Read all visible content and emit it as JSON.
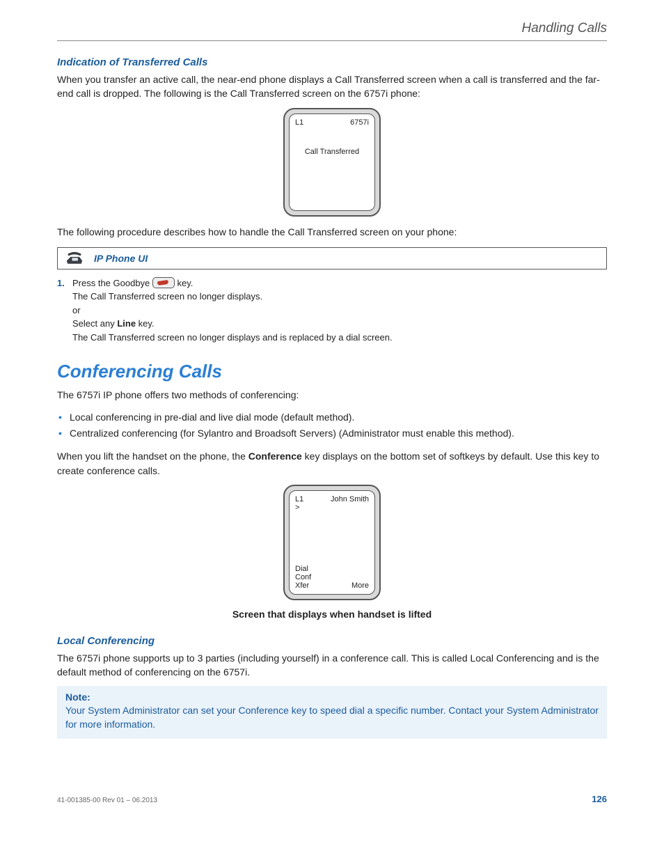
{
  "header": {
    "running": "Handling Calls"
  },
  "sec1": {
    "title": "Indication of Transferred Calls",
    "p1": "When you transfer an active call, the near-end phone displays a Call Transferred screen when a call is transferred and the far-end call is dropped. The following is the Call Transferred screen on the 6757i phone:",
    "p2": "The following procedure describes how to handle the Call Transferred screen on your phone:"
  },
  "phone1": {
    "line": "L1",
    "model": "6757i",
    "status": "Call Transferred"
  },
  "uiBox": {
    "label": "IP Phone UI"
  },
  "step1": {
    "num": "1.",
    "a1": "Press the Goodbye ",
    "a2": " key.",
    "b": "The Call Transferred screen no longer displays.",
    "c": "or",
    "d_pre": "Select any ",
    "d_bold": "Line",
    "d_post": " key.",
    "e": "The Call Transferred screen no longer displays and is replaced by a dial screen."
  },
  "sec2": {
    "title": "Conferencing Calls",
    "intro": "The 6757i IP phone offers two methods of conferencing:",
    "bullets": [
      "Local conferencing in pre-dial and live dial mode (default method).",
      "Centralized conferencing (for Sylantro and Broadsoft Servers) (Administrator must enable this method)."
    ],
    "p2_pre": "When you lift the handset on the phone, the ",
    "p2_bold": "Conference",
    "p2_post": " key displays on the bottom set of softkeys by default. Use this key to create conference calls."
  },
  "phone2": {
    "line": "L1",
    "arrow": ">",
    "name": "John Smith",
    "sk1": "Dial",
    "sk2": "Conf",
    "sk3": "Xfer",
    "sk4": "More"
  },
  "caption": "Screen that displays when handset is lifted",
  "sec3": {
    "title": "Local Conferencing",
    "p1": "The 6757i phone supports up to 3 parties (including yourself) in a conference call. This is called Local Conferencing and is the default method of conferencing on the 6757i."
  },
  "note": {
    "title": "Note:",
    "body": "Your System Administrator can set your Conference key to speed dial a specific number. Contact your System Administrator for more information."
  },
  "footer": {
    "doc": "41-001385-00 Rev 01 – 06.2013",
    "page": "126"
  }
}
